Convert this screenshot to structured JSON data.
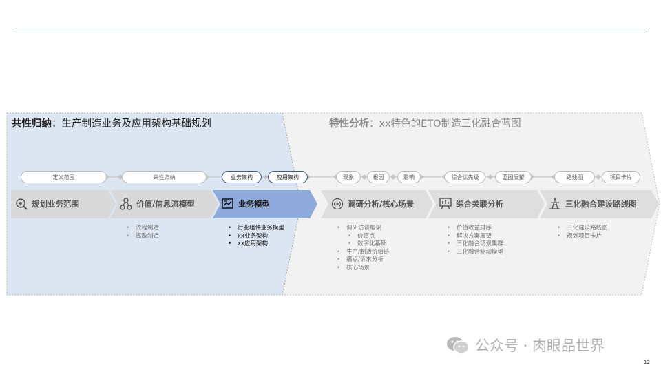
{
  "left_panel": {
    "title_bold": "共性归纳",
    "title_rest": "：生产制造业务及应用架构基础规划",
    "pills": [
      "定义范围",
      "共性归纳",
      "业务架构",
      "应用架构"
    ],
    "stages": [
      {
        "label": "规划业务范围",
        "icon": "magnifier-icon"
      },
      {
        "label": "价值/信息流模型",
        "icon": "network-nodes-icon"
      },
      {
        "label": "业务模型",
        "icon": "chart-box-icon"
      }
    ],
    "lists": [
      [
        "流程制造",
        "离散制造"
      ],
      [
        "行业组件业务模型",
        "xx业务架构",
        "xx应用架构"
      ]
    ]
  },
  "right_panel": {
    "title_bold": "特性分析",
    "title_rest": "：xx特色的ETO制造三化融合蓝图",
    "pills": [
      "现象",
      "根因",
      "影响",
      "综合优先级",
      "蓝图展望",
      "路线图",
      "项目卡片"
    ],
    "stages": [
      {
        "label": "调研分析/核心场景",
        "icon": "broadcast-icon"
      },
      {
        "label": "综合关联分析",
        "icon": "analysis-board-icon"
      },
      {
        "label": "三化融合建设路线图",
        "icon": "tower-icon"
      }
    ],
    "lists": [
      [
        {
          "text": "调研访谈框架",
          "level": 1
        },
        {
          "text": "价值点",
          "level": 2
        },
        {
          "text": "数字化基础",
          "level": 2
        },
        {
          "text": "生产/制造价值链",
          "level": 1
        },
        {
          "text": "痛点/诉求分析",
          "level": 1
        },
        {
          "text": "核心场景",
          "level": 1
        }
      ],
      [
        "价值收益排序",
        "解决方案展望",
        "三化融合场景集群",
        "三化融合驱动模型"
      ],
      [
        "三化建设路线图",
        "规划项目卡片"
      ]
    ]
  },
  "watermark": "公众号 · 肉眼品世界",
  "page_number": "12",
  "colors": {
    "left_panel_bg": "#dce6f2",
    "right_panel_bg": "#f2f2f2",
    "stage_bar": "#d9d9d9",
    "stage_active": "#8eaadb",
    "top_rule": "#1f4e4e"
  }
}
